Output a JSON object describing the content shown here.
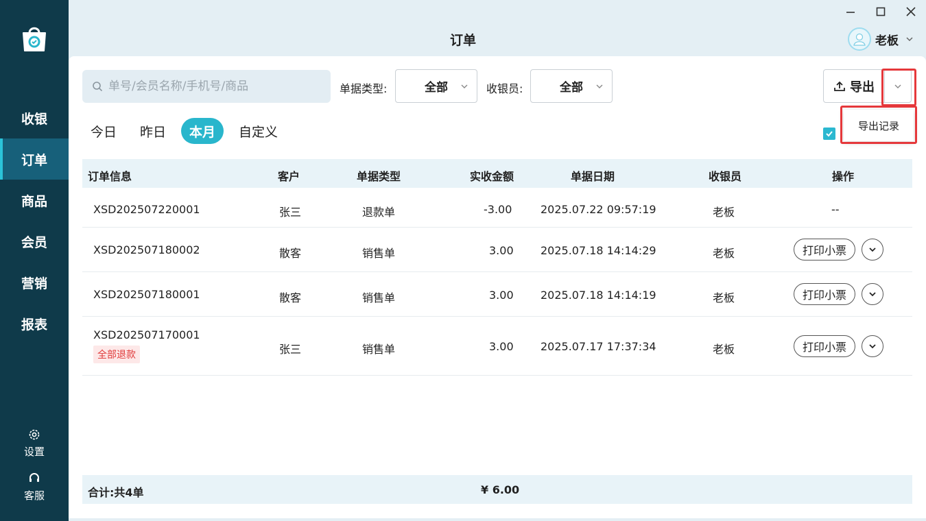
{
  "sidebar": {
    "items": [
      {
        "label": "收银",
        "active": false
      },
      {
        "label": "订单",
        "active": true
      },
      {
        "label": "商品",
        "active": false
      },
      {
        "label": "会员",
        "active": false
      },
      {
        "label": "营销",
        "active": false
      },
      {
        "label": "报表",
        "active": false
      }
    ],
    "settings_label": "设置",
    "service_label": "客服",
    "accent_color": "#2bc3d9"
  },
  "window": {
    "title": "订单",
    "user_name": "老板"
  },
  "toolbar": {
    "search_placeholder": "单号/会员名称/手机号/商品",
    "doc_type_label": "单据类型:",
    "doc_type_value": "全部",
    "cashier_label": "收银员:",
    "cashier_value": "全部",
    "export_label": "导出",
    "export_menu_item": "导出记录"
  },
  "tabs": [
    {
      "label": "今日",
      "active": false
    },
    {
      "label": "昨日",
      "active": false
    },
    {
      "label": "本月",
      "active": true
    },
    {
      "label": "自定义",
      "active": false
    }
  ],
  "table": {
    "columns": [
      "订单信息",
      "客户",
      "单据类型",
      "实收金额",
      "单据日期",
      "收银员",
      "操作"
    ],
    "rows": [
      {
        "order_no": "XSD202507220001",
        "customer": "张三",
        "type": "退款单",
        "amount": "-3.00",
        "date": "2025.07.22 09:57:19",
        "cashier": "老板",
        "action": "--",
        "badge": ""
      },
      {
        "order_no": "XSD202507180002",
        "customer": "散客",
        "type": "销售单",
        "amount": "3.00",
        "date": "2025.07.18 14:14:29",
        "cashier": "老板",
        "action": "打印小票",
        "badge": ""
      },
      {
        "order_no": "XSD202507180001",
        "customer": "散客",
        "type": "销售单",
        "amount": "3.00",
        "date": "2025.07.18 14:14:19",
        "cashier": "老板",
        "action": "打印小票",
        "badge": ""
      },
      {
        "order_no": "XSD202507170001",
        "customer": "张三",
        "type": "销售单",
        "amount": "3.00",
        "date": "2025.07.17 17:37:34",
        "cashier": "老板",
        "action": "打印小票",
        "badge": "全部退款"
      }
    ]
  },
  "summary": {
    "count_label": "合计:共4单",
    "total": "¥ 6.00"
  },
  "colors": {
    "sidebar_bg": "#0f3a4a",
    "active_tab": "#29b6cc",
    "highlight": "#e5383b"
  }
}
